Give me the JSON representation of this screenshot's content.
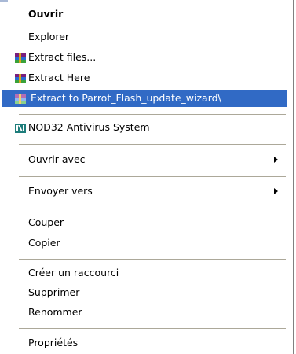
{
  "menu": {
    "items": [
      {
        "label": "Ouvrir",
        "style": "bold"
      },
      {
        "label": "Explorer"
      },
      {
        "label": "Extract files...",
        "icon": "winrar-icon"
      },
      {
        "label": "Extract Here",
        "icon": "winrar-icon"
      },
      {
        "label": "Extract to Parrot_Flash_update_wizard\\",
        "icon": "winrar-icon",
        "highlighted": true
      },
      {
        "label": "NOD32 Antivirus System",
        "icon": "nod32-icon"
      },
      {
        "label": "Ouvrir avec",
        "submenu": true
      },
      {
        "label": "Envoyer vers",
        "submenu": true
      },
      {
        "label": "Couper"
      },
      {
        "label": "Copier"
      },
      {
        "label": "Créer un raccourci"
      },
      {
        "label": "Supprimer"
      },
      {
        "label": "Renommer"
      },
      {
        "label": "Propriétés"
      }
    ]
  },
  "colors": {
    "highlight_bg": "#316ac5",
    "separator": "#aca899"
  }
}
